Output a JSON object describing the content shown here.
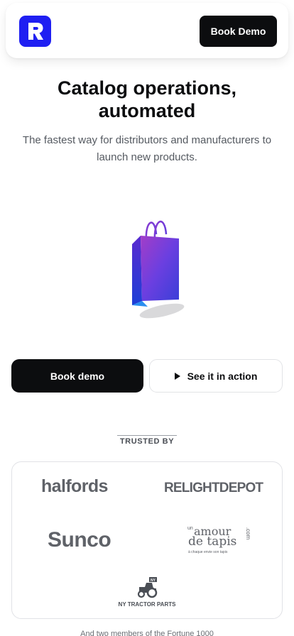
{
  "header": {
    "logo_letter": "R",
    "book_demo_label": "Book Demo"
  },
  "hero": {
    "title_line1": "Catalog operations,",
    "title_line2": "automated",
    "subtitle": "The fastest way for distributors and manufacturers to launch new products."
  },
  "cta": {
    "primary_label": "Book demo",
    "secondary_label": "See it in action"
  },
  "trusted": {
    "heading": "TRUSTED BY",
    "logos": {
      "halfords": "halfords",
      "relight": "RELIGHTDEPOT",
      "sunco": "Sunco",
      "amour_un": "un",
      "amour_main": "amour",
      "amour_tapis": "de tapis",
      "amour_com": ".com",
      "amour_tagline": "à chaque envie son tapis",
      "tractor_badge": "NY",
      "tractor_name": "NY TRACTOR PARTS"
    }
  },
  "footnote": "And two members of the Fortune 1000",
  "colors": {
    "brand_blue": "#1f1ff2",
    "dark": "#0c0d0f",
    "logo_gray": "#5f6268"
  }
}
